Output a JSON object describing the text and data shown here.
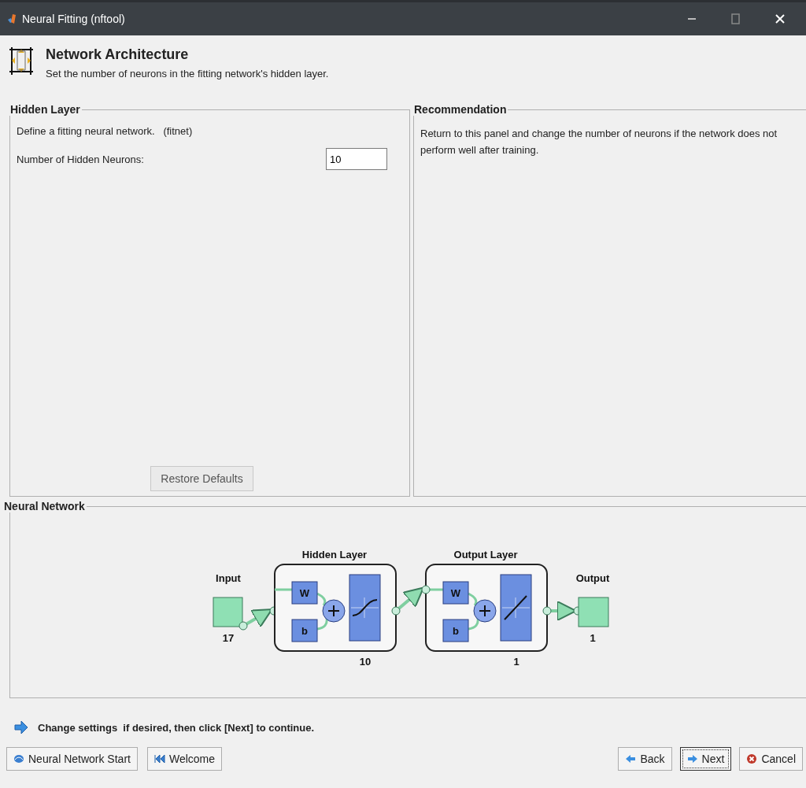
{
  "window": {
    "title": "Neural Fitting (nftool)"
  },
  "header": {
    "title": "Network Architecture",
    "subtitle": "Set the number of neurons in the fitting network's hidden layer."
  },
  "hidden_layer": {
    "title": "Hidden Layer",
    "description": "Define a fitting neural network.   (fitnet)",
    "neurons_label": "Number of Hidden Neurons:",
    "neurons_value": "10",
    "restore_button": "Restore Defaults"
  },
  "recommendation": {
    "title": "Recommendation",
    "text": "Return to this panel and change the number of neurons if the network does not perform well after training."
  },
  "neural_network": {
    "title": "Neural Network",
    "input": {
      "label": "Input",
      "size": "17"
    },
    "layers": [
      {
        "title": "Hidden Layer",
        "size": "10",
        "weight_label": "W",
        "bias_label": "b",
        "kind": "sigmoid"
      },
      {
        "title": "Output Layer",
        "size": "1",
        "weight_label": "W",
        "bias_label": "b",
        "kind": "linear"
      }
    ],
    "output": {
      "label": "Output",
      "size": "1"
    }
  },
  "instruction": "Change settings  if desired, then click [Next] to continue.",
  "left_buttons": [
    {
      "label": "Neural Network Start",
      "kind": "start",
      "focused": false
    },
    {
      "label": "Welcome",
      "kind": "welcome",
      "focused": false
    }
  ],
  "right_buttons": [
    {
      "label": "Back",
      "kind": "back",
      "focused": false
    },
    {
      "label": "Next",
      "kind": "next",
      "focused": true
    },
    {
      "label": "Cancel",
      "kind": "cancel",
      "focused": false
    }
  ]
}
